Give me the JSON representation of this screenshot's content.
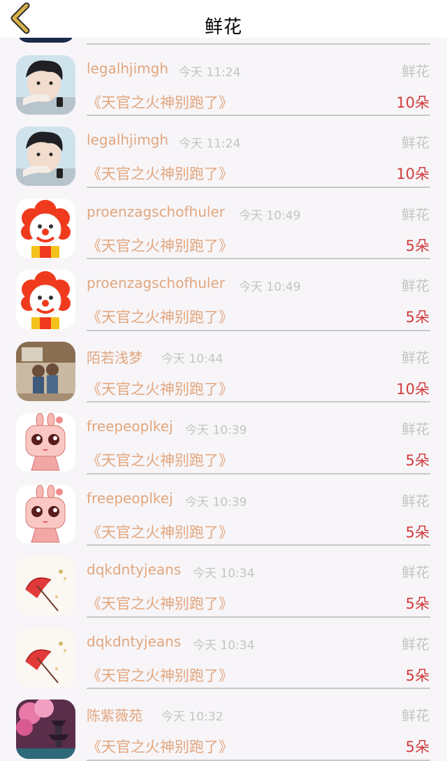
{
  "header": {
    "title": "鲜花"
  },
  "rows": [
    {
      "username": "",
      "time": "",
      "gift": "",
      "book": "",
      "amount": "",
      "avatar": "partial-avatar"
    },
    {
      "username": "legalhjimgh",
      "time": "今天 11:24",
      "gift": "鲜花",
      "book": "《天官之火神别跑了》",
      "amount": "10朵",
      "avatar": "boy-photo"
    },
    {
      "username": "legalhjimgh",
      "time": "今天 11:24",
      "gift": "鲜花",
      "book": "《天官之火神别跑了》",
      "amount": "10朵",
      "avatar": "boy-photo"
    },
    {
      "username": "proenzagschofhuler",
      "time": "今天 10:49",
      "gift": "鲜花",
      "book": "《天官之火神别跑了》",
      "amount": "5朵",
      "avatar": "clown"
    },
    {
      "username": "proenzagschofhuler",
      "time": "今天 10:49",
      "gift": "鲜花",
      "book": "《天官之火神别跑了》",
      "amount": "5朵",
      "avatar": "clown"
    },
    {
      "username": "陌若浅梦",
      "time": "今天 10:44",
      "gift": "鲜花",
      "book": "《天官之火神别跑了》",
      "amount": "10朵",
      "avatar": "couple-photo"
    },
    {
      "username": "freepeoplkej",
      "time": "今天 10:39",
      "gift": "鲜花",
      "book": "《天官之火神别跑了》",
      "amount": "5朵",
      "avatar": "pink-bunny"
    },
    {
      "username": "freepeoplkej",
      "time": "今天 10:39",
      "gift": "鲜花",
      "book": "《天官之火神别跑了》",
      "amount": "5朵",
      "avatar": "pink-bunny"
    },
    {
      "username": "dqkdntyjeans",
      "time": "今天 10:34",
      "gift": "鲜花",
      "book": "《天官之火神别跑了》",
      "amount": "5朵",
      "avatar": "red-umbrella"
    },
    {
      "username": "dqkdntyjeans",
      "time": "今天 10:34",
      "gift": "鲜花",
      "book": "《天官之火神别跑了》",
      "amount": "5朵",
      "avatar": "red-umbrella"
    },
    {
      "username": "陈紫薇苑",
      "time": "今天 10:32",
      "gift": "鲜花",
      "book": "《天官之火神别跑了》",
      "amount": "5朵",
      "avatar": "blossom-pagoda"
    }
  ],
  "colors": {
    "accent": "#e2a67e",
    "amount": "#d23c3c",
    "muted": "#c4c4c4",
    "back_icon": "#d8b24a"
  }
}
